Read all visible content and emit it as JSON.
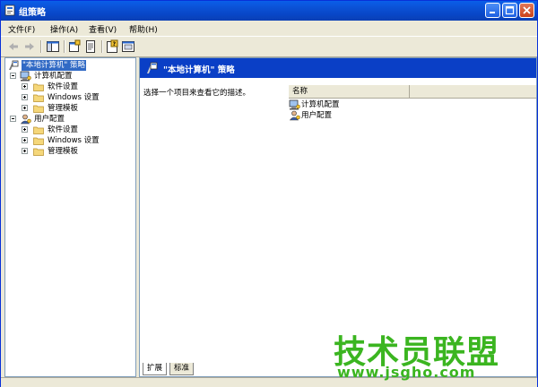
{
  "window": {
    "title": "组策略"
  },
  "menu": {
    "items": [
      {
        "label": "文件(F)"
      },
      {
        "label": "操作(A)"
      },
      {
        "label": "查看(V)"
      },
      {
        "label": "帮助(H)"
      }
    ]
  },
  "toolbar": {
    "buttons": [
      "back-icon",
      "forward-icon",
      "show-hide-tree-icon",
      "properties-icon",
      "export-icon",
      "help-icon",
      "console-icon"
    ]
  },
  "tree": {
    "root": "\"本地计算机\" 策略",
    "computer_config": "计算机配置",
    "computer_children": [
      "软件设置",
      "Windows 设置",
      "管理模板"
    ],
    "user_config": "用户配置",
    "user_children": [
      "软件设置",
      "Windows 设置",
      "管理模板"
    ]
  },
  "details": {
    "header": "\"本地计算机\" 策略",
    "description": "选择一个项目来查看它的描述。",
    "column_name": "名称",
    "rows": [
      "计算机配置",
      "用户配置"
    ]
  },
  "tabs": {
    "extended": "扩展",
    "standard": "标准"
  },
  "watermark": {
    "brand": "技术员联盟",
    "url": "www.jsgho.com"
  },
  "colors": {
    "titlebar": "#0a5fe9",
    "selection": "#316ac5",
    "header_band": "#0a3fc6",
    "watermark": "#3bb520"
  }
}
